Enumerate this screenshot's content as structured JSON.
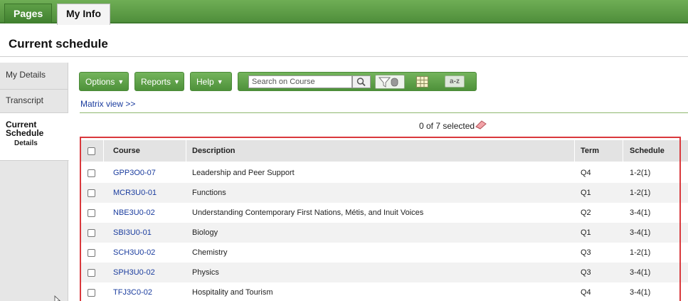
{
  "top_tabs": [
    "Pages",
    "My Info"
  ],
  "page_title": "Current schedule",
  "sidenav": {
    "my_details": "My Details",
    "transcript": "Transcript",
    "current_schedule": "Current Schedule",
    "current_schedule_sub": "Details"
  },
  "toolbar": {
    "options": "Options",
    "reports": "Reports",
    "help": "Help",
    "search_placeholder": "Search on Course",
    "az": "a-z"
  },
  "matrix_link": "Matrix view >>",
  "selection": "0 of 7 selected",
  "table": {
    "headers": {
      "course": "Course",
      "description": "Description",
      "term": "Term",
      "schedule": "Schedule"
    },
    "rows": [
      {
        "course": "GPP3O0-07",
        "description": "Leadership and Peer Support",
        "term": "Q4",
        "schedule": "1-2(1)"
      },
      {
        "course": "MCR3U0-01",
        "description": "Functions",
        "term": "Q1",
        "schedule": "1-2(1)"
      },
      {
        "course": "NBE3U0-02",
        "description": "Understanding Contemporary First Nations, Métis, and Inuit Voices",
        "term": "Q2",
        "schedule": "3-4(1)"
      },
      {
        "course": "SBI3U0-01",
        "description": "Biology",
        "term": "Q1",
        "schedule": "3-4(1)"
      },
      {
        "course": "SCH3U0-02",
        "description": "Chemistry",
        "term": "Q3",
        "schedule": "1-2(1)"
      },
      {
        "course": "SPH3U0-02",
        "description": "Physics",
        "term": "Q3",
        "schedule": "3-4(1)"
      },
      {
        "course": "TFJ3C0-02",
        "description": "Hospitality and Tourism",
        "term": "Q4",
        "schedule": "3-4(1)"
      }
    ]
  },
  "colors": {
    "accent_green": "#5a9e44",
    "link_blue": "#1a3c9e",
    "highlight_red": "#d9383c"
  }
}
